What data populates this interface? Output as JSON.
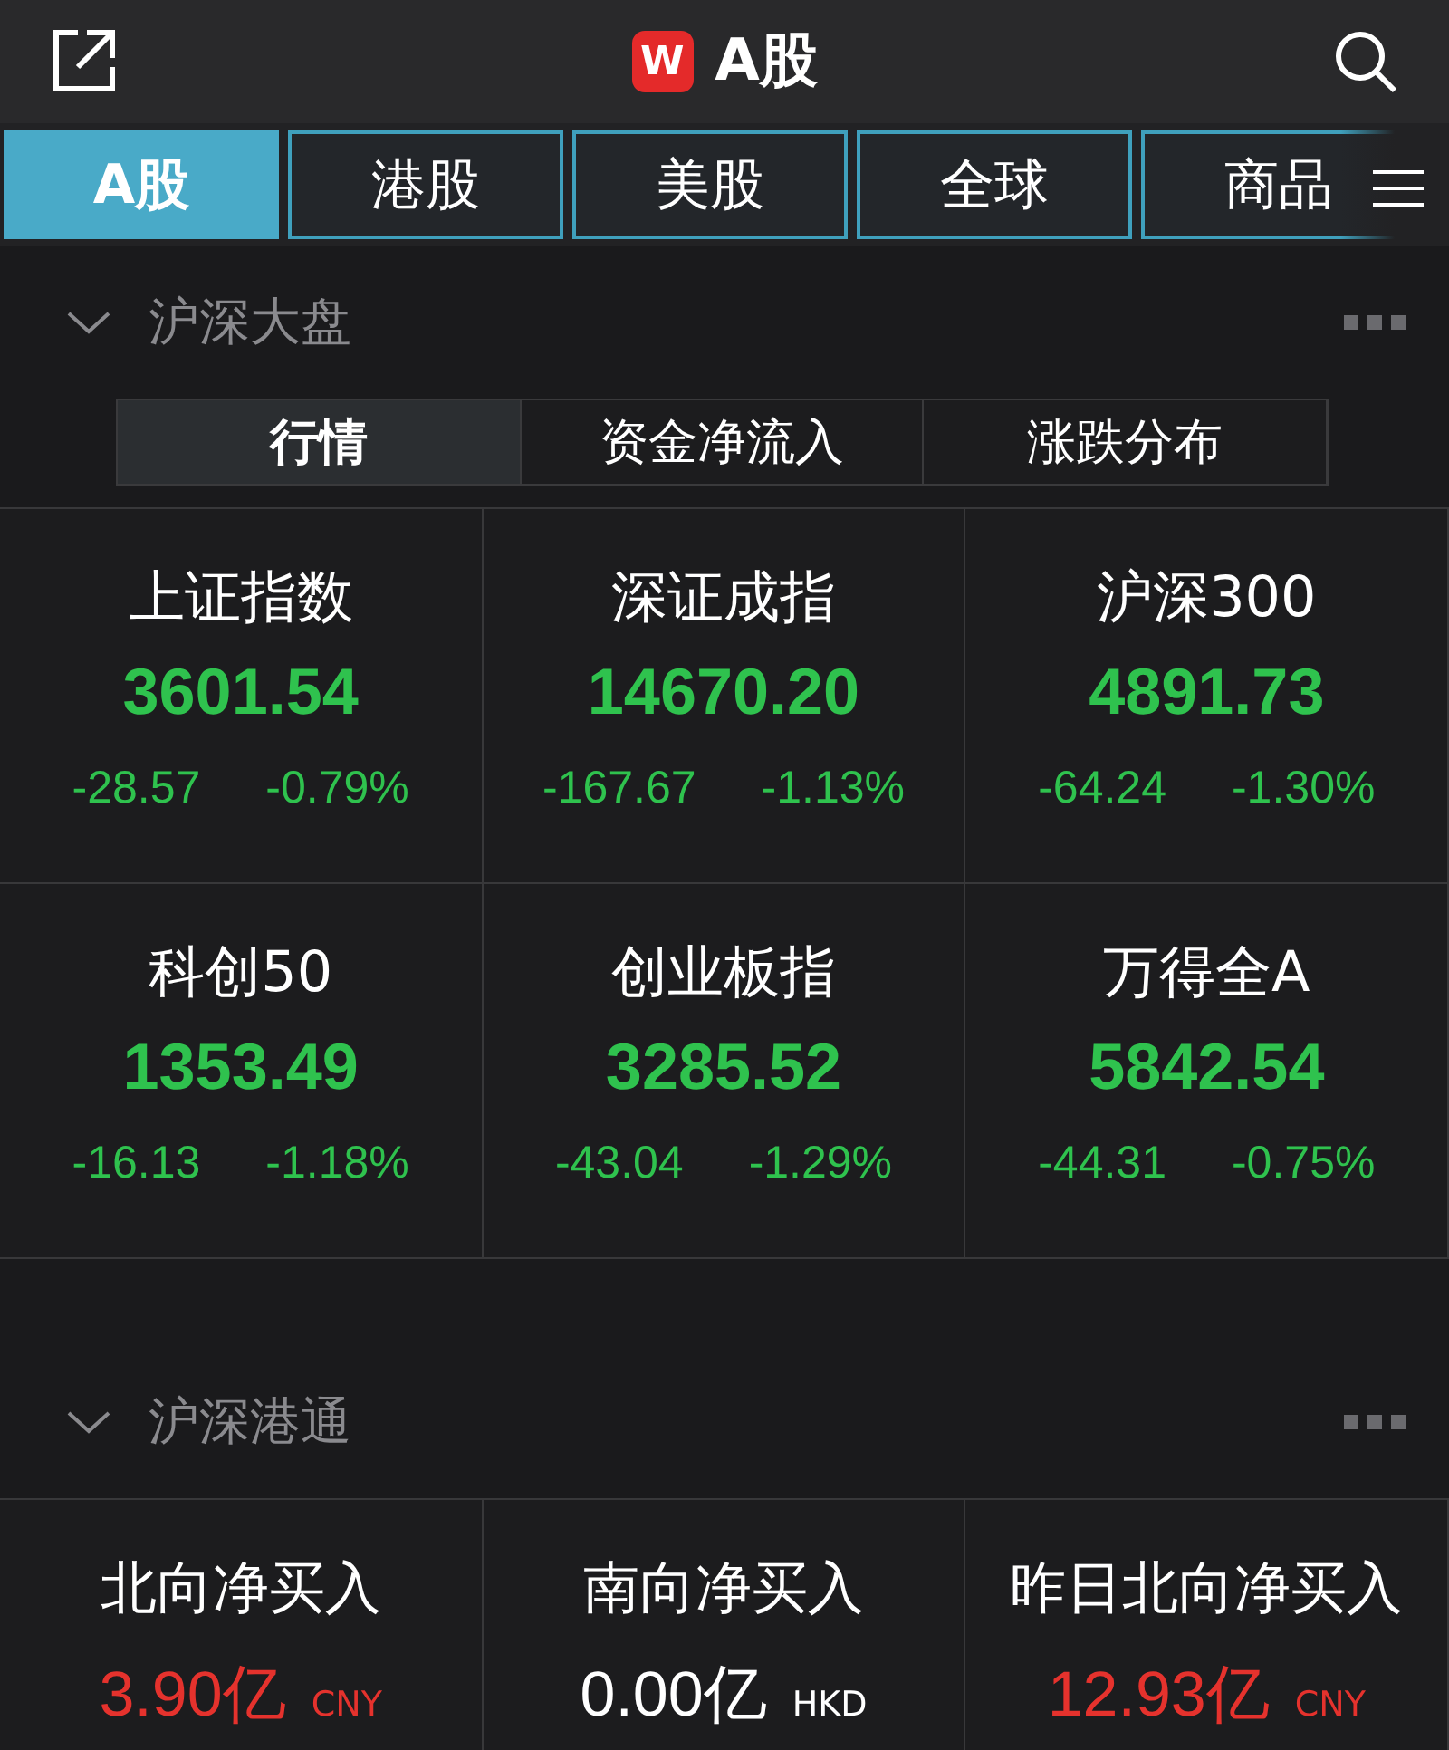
{
  "header": {
    "title": "A股",
    "logo": "W"
  },
  "tabs": [
    {
      "label": "A股",
      "selected": true
    },
    {
      "label": "港股",
      "selected": false
    },
    {
      "label": "美股",
      "selected": false
    },
    {
      "label": "全球",
      "selected": false
    },
    {
      "label": "商品",
      "selected": false
    }
  ],
  "market_section": {
    "title": "沪深大盘",
    "expanded": true,
    "segments": [
      {
        "label": "行情",
        "selected": true
      },
      {
        "label": "资金净流入",
        "selected": false
      },
      {
        "label": "涨跌分布",
        "selected": false
      }
    ],
    "indices": [
      {
        "name": "上证指数",
        "value": "3601.54",
        "change": "-28.57",
        "percent": "-0.79%",
        "color": "#2fc24e"
      },
      {
        "name": "深证成指",
        "value": "14670.20",
        "change": "-167.67",
        "percent": "-1.13%",
        "color": "#2fc24e"
      },
      {
        "name": "沪深300",
        "value": "4891.73",
        "change": "-64.24",
        "percent": "-1.30%",
        "color": "#2fc24e"
      },
      {
        "name": "科创50",
        "value": "1353.49",
        "change": "-16.13",
        "percent": "-1.18%",
        "color": "#2fc24e"
      },
      {
        "name": "创业板指",
        "value": "3285.52",
        "change": "-43.04",
        "percent": "-1.29%",
        "color": "#2fc24e"
      },
      {
        "name": "万得全A",
        "value": "5842.54",
        "change": "-44.31",
        "percent": "-0.75%",
        "color": "#2fc24e"
      }
    ]
  },
  "connect_section": {
    "title": "沪深港通",
    "expanded": true,
    "flows": [
      {
        "name": "北向净买入",
        "value": "3.90亿",
        "currency": "CNY",
        "color": "#e5322d"
      },
      {
        "name": "南向净买入",
        "value": "0.00亿",
        "currency": "HKD",
        "color": "#ffffff"
      },
      {
        "name": "昨日北向净买入",
        "value": "12.93亿",
        "currency": "CNY",
        "color": "#e5322d"
      }
    ]
  }
}
